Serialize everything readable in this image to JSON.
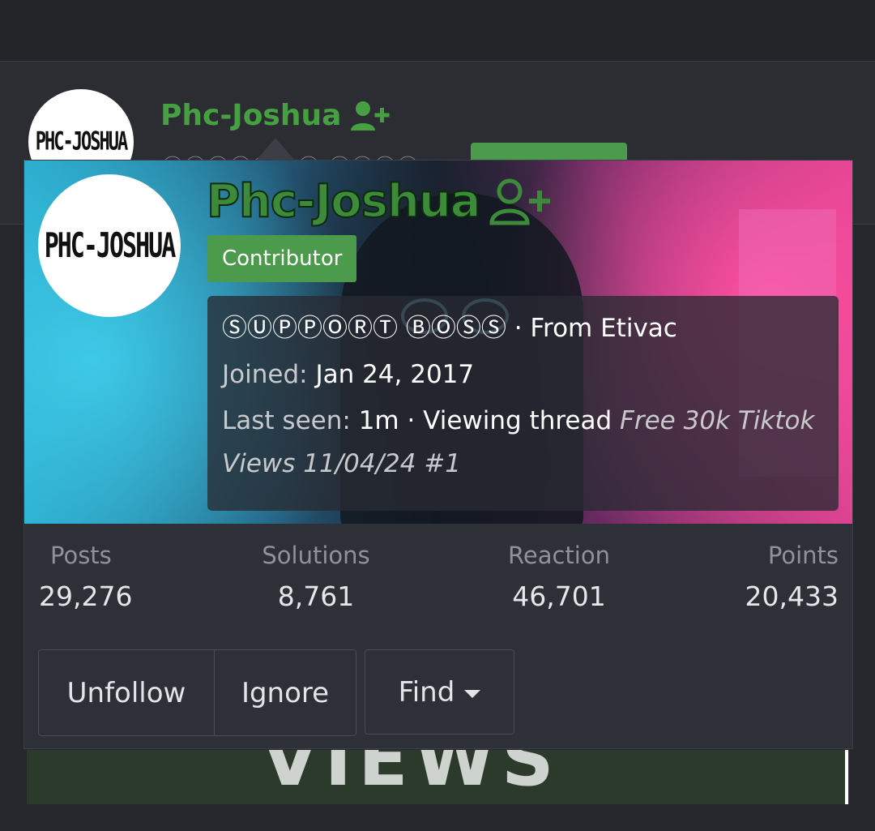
{
  "background": {
    "username": "Phc-Joshua",
    "partial_title": "ⓈⓊⓅⓅⓄⓇⓉ ⒷⓄⓈⓈ",
    "lower_text": "VIEWS",
    "avatar_text": "PHC-JOSHUA"
  },
  "card": {
    "avatar_text": "PHC-JOSHUA",
    "username": "Phc-Joshua",
    "badge": "Contributor",
    "title": "ⓈⓊⓅⓅⓄⓇⓉ ⒷⓄⓈⓈ",
    "location": "· From Etivac",
    "joined_label": "Joined:",
    "joined_value": "Jan 24, 2017",
    "last_seen_label": "Last seen:",
    "last_seen_value": "1m",
    "activity": "· Viewing thread",
    "thread_title": "Free 30k Tiktok Views 11/04/24 #1"
  },
  "stats": [
    {
      "label": "Posts",
      "value": "29,276"
    },
    {
      "label": "Solutions",
      "value": "8,761"
    },
    {
      "label": "Reaction",
      "value": "46,701"
    },
    {
      "label": "Points",
      "value": "20,433"
    }
  ],
  "buttons": {
    "unfollow": "Unfollow",
    "ignore": "Ignore",
    "find": "Find"
  },
  "icons": {
    "follow": "user-plus-icon",
    "dropdown": "caret-down-icon"
  },
  "colors": {
    "username_green": "#3d8b3a",
    "badge_green": "#4c9a4c",
    "card_bg": "#2e3037"
  }
}
